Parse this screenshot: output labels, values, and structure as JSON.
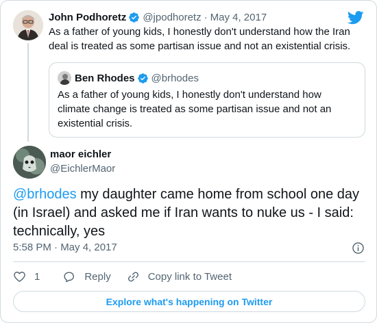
{
  "parent_tweet": {
    "author_name": "John Podhoretz",
    "handle": "@jpodhoretz",
    "separator": "·",
    "date": "May 4, 2017",
    "text": "As a father of young kids, I honestly don't understand how the Iran deal is treated as some partisan issue and not an existential crisis."
  },
  "quoted_tweet": {
    "author_name": "Ben Rhodes",
    "handle": "@brhodes",
    "text": "As a father of young kids, I honestly don't understand how climate change is treated as some partisan issue and not an existential crisis."
  },
  "main_tweet": {
    "author_name": "maor eichler",
    "handle": "@EichlerMaor",
    "mention": "@brhodes",
    "text": " my daughter came home from school one day (in Israel) and asked me if Iran wants to nuke us - I said: technically, yes",
    "timestamp": "5:58 PM · May 4, 2017"
  },
  "actions": {
    "like_count": "1",
    "reply_label": "Reply",
    "copy_link_label": "Copy link to Tweet"
  },
  "explore_label": "Explore what's happening on Twitter",
  "icons": {
    "brand": "twitter-bird-icon",
    "verified": "verified-badge-icon",
    "info": "info-icon",
    "like": "heart-icon",
    "reply": "reply-bubble-icon",
    "copy": "link-icon"
  },
  "colors": {
    "accent": "#1d9bf0",
    "text": "#0f1419",
    "secondary": "#536471",
    "border": "#cfd9de"
  }
}
